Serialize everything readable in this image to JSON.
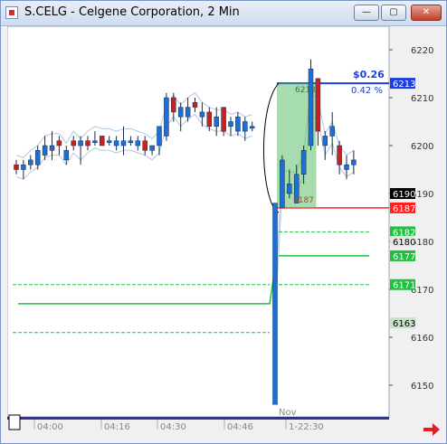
{
  "window": {
    "title": "S.CELG - Celgene Corporation, 2 Min",
    "buttons": {
      "minimize": "—",
      "maximize": "▢",
      "close": "✕"
    },
    "colors": {
      "frame": "#7a96c8",
      "titlebar": "#dbe5f3"
    }
  },
  "chart_data": {
    "type": "candlestick",
    "symbol": "S.CELG",
    "interval": "2 Min",
    "ylim": [
      61.45,
      62.25
    ],
    "yticks": [
      "6150",
      "6160",
      "6170",
      "6180",
      "6190",
      "6200",
      "6210",
      "6220"
    ],
    "xticks": [
      "04:00",
      "04:16",
      "04:30",
      "04:46",
      "1-22:30"
    ],
    "x_extra_label": "Nov",
    "candles": [
      {
        "o": 61.95,
        "h": 61.97,
        "l": 61.94,
        "c": 61.96,
        "t": "dn"
      },
      {
        "o": 61.96,
        "h": 61.97,
        "l": 61.93,
        "c": 61.95,
        "t": "up"
      },
      {
        "o": 61.96,
        "h": 61.98,
        "l": 61.95,
        "c": 61.97,
        "t": "up"
      },
      {
        "o": 61.96,
        "h": 62.0,
        "l": 61.95,
        "c": 61.99,
        "t": "up"
      },
      {
        "o": 61.98,
        "h": 62.02,
        "l": 61.97,
        "c": 62.0,
        "t": "up"
      },
      {
        "o": 61.99,
        "h": 62.03,
        "l": 61.97,
        "c": 62.0,
        "t": "up"
      },
      {
        "o": 62.01,
        "h": 62.02,
        "l": 61.98,
        "c": 62.0,
        "t": "dn"
      },
      {
        "o": 61.97,
        "h": 62.0,
        "l": 61.96,
        "c": 61.99,
        "t": "up"
      },
      {
        "o": 62.0,
        "h": 62.02,
        "l": 61.99,
        "c": 62.01,
        "t": "dn"
      },
      {
        "o": 62.0,
        "h": 62.02,
        "l": 61.96,
        "c": 62.01,
        "t": "up"
      },
      {
        "o": 62.0,
        "h": 62.02,
        "l": 61.99,
        "c": 62.01,
        "t": "dn"
      },
      {
        "o": 62.01,
        "h": 62.03,
        "l": 62.0,
        "c": 62.01,
        "t": "up"
      },
      {
        "o": 62.02,
        "h": 62.02,
        "l": 62.0,
        "c": 62.0,
        "t": "dn"
      },
      {
        "o": 62.01,
        "h": 62.02,
        "l": 62.0,
        "c": 62.01,
        "t": "up"
      },
      {
        "o": 62.01,
        "h": 62.02,
        "l": 61.99,
        "c": 62.0,
        "t": "up"
      },
      {
        "o": 62.0,
        "h": 62.04,
        "l": 61.98,
        "c": 62.01,
        "t": "up"
      },
      {
        "o": 62.01,
        "h": 62.02,
        "l": 62.0,
        "c": 62.01,
        "t": "up"
      },
      {
        "o": 62.0,
        "h": 62.02,
        "l": 61.99,
        "c": 62.01,
        "t": "up"
      },
      {
        "o": 62.01,
        "h": 62.02,
        "l": 61.98,
        "c": 61.99,
        "t": "dn"
      },
      {
        "o": 61.99,
        "h": 62.0,
        "l": 61.98,
        "c": 62.0,
        "t": "up"
      },
      {
        "o": 62.0,
        "h": 62.03,
        "l": 61.98,
        "c": 62.04,
        "t": "up"
      },
      {
        "o": 62.02,
        "h": 62.11,
        "l": 62.01,
        "c": 62.1,
        "t": "up"
      },
      {
        "o": 62.1,
        "h": 62.11,
        "l": 62.05,
        "c": 62.07,
        "t": "dn"
      },
      {
        "o": 62.06,
        "h": 62.09,
        "l": 62.03,
        "c": 62.08,
        "t": "up"
      },
      {
        "o": 62.06,
        "h": 62.1,
        "l": 62.05,
        "c": 62.08,
        "t": "up"
      },
      {
        "o": 62.09,
        "h": 62.1,
        "l": 62.07,
        "c": 62.08,
        "t": "dn"
      },
      {
        "o": 62.06,
        "h": 62.09,
        "l": 62.04,
        "c": 62.07,
        "t": "up"
      },
      {
        "o": 62.07,
        "h": 62.08,
        "l": 62.03,
        "c": 62.04,
        "t": "dn"
      },
      {
        "o": 62.04,
        "h": 62.08,
        "l": 62.02,
        "c": 62.06,
        "t": "up"
      },
      {
        "o": 62.08,
        "h": 62.08,
        "l": 62.02,
        "c": 62.03,
        "t": "dn"
      },
      {
        "o": 62.04,
        "h": 62.06,
        "l": 62.02,
        "c": 62.05,
        "t": "up"
      },
      {
        "o": 62.03,
        "h": 62.07,
        "l": 62.02,
        "c": 62.06,
        "t": "up"
      },
      {
        "o": 62.05,
        "h": 62.06,
        "l": 62.01,
        "c": 62.03,
        "t": "up"
      },
      {
        "o": 62.04,
        "h": 62.05,
        "l": 62.03,
        "c": 62.04,
        "t": "up"
      },
      {
        "o": 61.46,
        "h": 61.87,
        "l": 61.46,
        "c": 61.88,
        "t": "up"
      },
      {
        "o": 61.87,
        "h": 61.98,
        "l": 61.87,
        "c": 61.97,
        "t": "up"
      },
      {
        "o": 61.9,
        "h": 61.95,
        "l": 61.89,
        "c": 61.92,
        "t": "up"
      },
      {
        "o": 61.88,
        "h": 61.96,
        "l": 61.88,
        "c": 61.94,
        "t": "up"
      },
      {
        "o": 61.94,
        "h": 62.0,
        "l": 61.92,
        "c": 61.99,
        "t": "up"
      },
      {
        "o": 62.0,
        "h": 62.18,
        "l": 61.99,
        "c": 62.16,
        "t": "up"
      },
      {
        "o": 62.14,
        "h": 62.14,
        "l": 62.0,
        "c": 62.03,
        "t": "dn"
      },
      {
        "o": 62.0,
        "h": 62.03,
        "l": 61.97,
        "c": 62.02,
        "t": "up"
      },
      {
        "o": 62.02,
        "h": 62.07,
        "l": 61.98,
        "c": 62.04,
        "t": "up"
      },
      {
        "o": 62.0,
        "h": 62.01,
        "l": 61.94,
        "c": 61.96,
        "t": "dn"
      },
      {
        "o": 61.96,
        "h": 61.98,
        "l": 61.93,
        "c": 61.95,
        "t": "up"
      },
      {
        "o": 61.96,
        "h": 61.99,
        "l": 61.94,
        "c": 61.97,
        "t": "up"
      }
    ],
    "candle_slots_before_gap": 34,
    "candle_gap_slots": 6,
    "price_tags": [
      {
        "label": "6213",
        "value": 62.13,
        "bg": "#1c3ee0",
        "fg": "#ffffff"
      },
      {
        "label": "6190",
        "value": 61.9,
        "bg": "#000000",
        "fg": "#ffffff"
      },
      {
        "label": "6187",
        "value": 61.87,
        "bg": "#ff2020",
        "fg": "#ffffff"
      },
      {
        "label": "6182",
        "value": 61.82,
        "bg": "#20c040",
        "fg": "#ffffff"
      },
      {
        "label": "6180",
        "value": 61.8,
        "bg": "#e8e8e8",
        "fg": "#000000"
      },
      {
        "label": "6177",
        "value": 61.77,
        "bg": "#20c040",
        "fg": "#ffffff"
      },
      {
        "label": "6171",
        "value": 61.71,
        "bg": "#20c040",
        "fg": "#ffffff"
      },
      {
        "label": "6163",
        "value": 61.63,
        "bg": "#c8e0c8",
        "fg": "#000000"
      }
    ],
    "hlines": [
      {
        "value": 62.13,
        "color": "#1c3ee0",
        "dash": false
      },
      {
        "value": 61.87,
        "color": "#ff2020",
        "dash": false
      },
      {
        "value": 61.82,
        "color": "#20c040",
        "dash": true
      },
      {
        "value": 61.77,
        "color": "#20c040",
        "dash": false
      },
      {
        "value": 61.71,
        "color": "#20c040",
        "dash": true
      },
      {
        "value": 61.71,
        "color": "#20c040",
        "dash": true
      },
      {
        "value": 61.67,
        "color": "#20c040",
        "dash": false
      },
      {
        "value": 61.61,
        "color": "#20c040",
        "dash": true
      }
    ],
    "annotations": {
      "change": "$0.26",
      "change_pct": "0.42 %",
      "box_top_label": "6213",
      "box_bottom_label": "6187"
    },
    "colors": {
      "up": "#1a6fd8",
      "down": "#cc2020",
      "band": "#b0c8e0",
      "background": "#ffffff"
    }
  }
}
